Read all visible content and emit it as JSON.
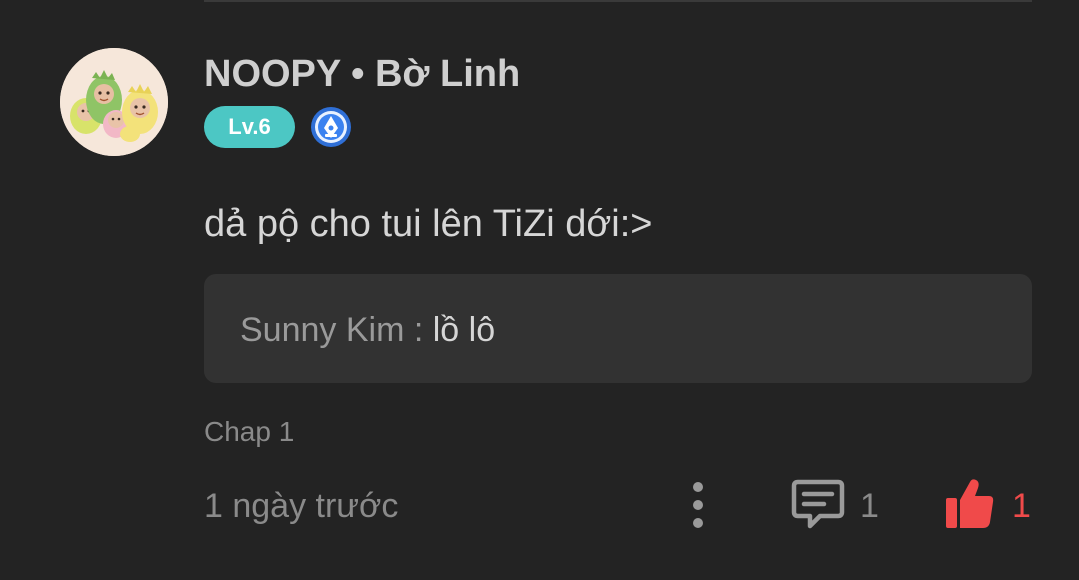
{
  "comment": {
    "username": "NOOPY • Bờ Linh",
    "level": "Lv.6",
    "badge_icon": "pen-nib-badge-icon",
    "text": "dả pộ cho tui lên TiZi dới:>",
    "reply_preview": {
      "author": "Sunny Kim",
      "separator": " : ",
      "text": "lồ lô"
    },
    "chapter": "Chap 1",
    "timestamp": "1 ngày trước",
    "reply_count": "1",
    "like_count": "1"
  },
  "colors": {
    "background": "#232323",
    "level_badge": "#4cc7c4",
    "like_accent": "#f04a4a",
    "reply_box": "#323232"
  },
  "icons": {
    "more": "more-vertical-icon",
    "reply": "comment-bubble-icon",
    "like": "thumbs-up-icon"
  }
}
